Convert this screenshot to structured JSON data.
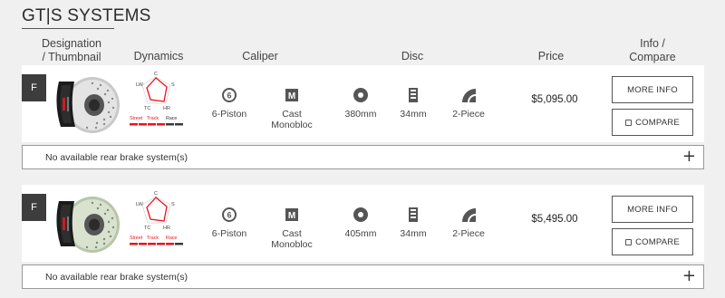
{
  "section": {
    "title": "GT|S SYSTEMS"
  },
  "headers": {
    "designation": "Designation\n/ Thumbnail",
    "designation_l1": "Designation",
    "designation_l2": "/ Thumbnail",
    "dynamics": "Dynamics",
    "caliper": "Caliper",
    "disc": "Disc",
    "price": "Price",
    "info_l1": "Info /",
    "info_l2": "Compare"
  },
  "dynamics_chart": {
    "axes": [
      "C",
      "S",
      "HR",
      "TC",
      "LW"
    ],
    "scale": [
      "Street",
      "Track",
      "Race"
    ],
    "accent": "#e8141b",
    "inactive": "#3a3a3a"
  },
  "products": [
    {
      "position": "F",
      "dynamics_scale_level": 3,
      "dynamics_values": [
        0.85,
        0.55,
        0.7,
        0.5,
        0.6
      ],
      "caliper_pistons": "6-Piston",
      "caliper_type": "Cast\nMonobloc",
      "caliper_type_l1": "Cast",
      "caliper_type_l2": "Monobloc",
      "disc_size": "380mm",
      "disc_thickness": "34mm",
      "disc_type": "2-Piece",
      "price": "$5,095.00",
      "more_info": "MORE INFO",
      "compare": "COMPARE",
      "rear": "No available rear brake system(s)",
      "expand": "+"
    },
    {
      "position": "F",
      "dynamics_scale_level": 3,
      "dynamics_values": [
        0.85,
        0.55,
        0.7,
        0.5,
        0.6
      ],
      "caliper_pistons": "6-Piston",
      "caliper_type": "Cast\nMonobloc",
      "caliper_type_l1": "Cast",
      "caliper_type_l2": "Monobloc",
      "disc_size": "405mm",
      "disc_thickness": "34mm",
      "disc_type": "2-Piece",
      "price": "$5,495.00",
      "more_info": "MORE INFO",
      "compare": "COMPARE",
      "rear": "No available rear brake system(s)",
      "expand": "+"
    }
  ],
  "icons": {
    "pistons": "piston-count-icon",
    "caliper_type": "monobloc-icon",
    "disc_size": "disc-diameter-icon",
    "disc_thickness": "disc-thickness-icon",
    "disc_type": "two-piece-disc-icon"
  }
}
